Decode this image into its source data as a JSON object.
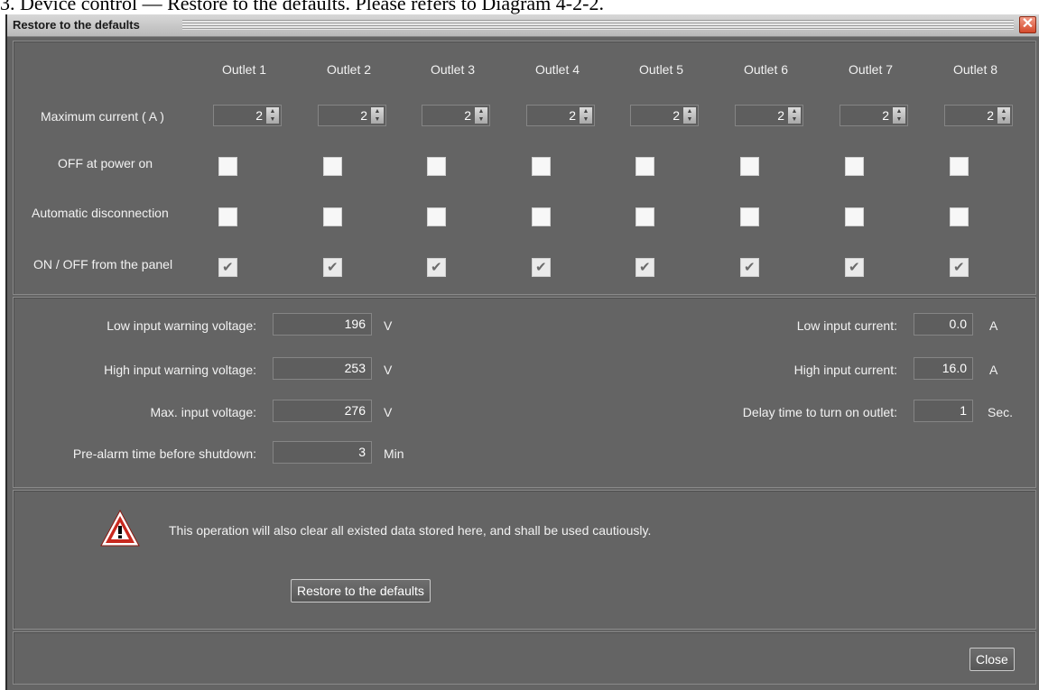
{
  "doc_caption": "3. Device control — Restore to the defaults. Please refers to Diagram 4-2-2.",
  "window": {
    "title": "Restore to the defaults"
  },
  "outlets": {
    "headers": [
      "Outlet 1",
      "Outlet 2",
      "Outlet 3",
      "Outlet 4",
      "Outlet 5",
      "Outlet 6",
      "Outlet 7",
      "Outlet 8"
    ],
    "max_current_label": "Maximum current ( A )",
    "max_current_values": [
      "2",
      "2",
      "2",
      "2",
      "2",
      "2",
      "2",
      "2"
    ],
    "off_at_power_on_label": "OFF at power on",
    "off_at_power_on": [
      false,
      false,
      false,
      false,
      false,
      false,
      false,
      false
    ],
    "auto_disconnect_label": "Automatic disconnection",
    "auto_disconnect": [
      false,
      false,
      false,
      false,
      false,
      false,
      false,
      false
    ],
    "panel_onoff_label": "ON / OFF from the panel",
    "panel_onoff": [
      true,
      true,
      true,
      true,
      true,
      true,
      true,
      true
    ]
  },
  "settings": {
    "low_input_warning_voltage": {
      "label": "Low input warning voltage:",
      "value": "196",
      "unit": "V"
    },
    "high_input_warning_voltage": {
      "label": "High input warning voltage:",
      "value": "253",
      "unit": "V"
    },
    "max_input_voltage": {
      "label": "Max. input voltage:",
      "value": "276",
      "unit": "V"
    },
    "pre_alarm_time": {
      "label": "Pre-alarm time before shutdown:",
      "value": "3",
      "unit": "Min"
    },
    "low_input_current": {
      "label": "Low input current:",
      "value": "0.0",
      "unit": "A"
    },
    "high_input_current": {
      "label": "High input current:",
      "value": "16.0",
      "unit": "A"
    },
    "delay_time": {
      "label": "Delay time to turn on outlet:",
      "value": "1",
      "unit": "Sec."
    }
  },
  "warning": {
    "text": "This operation will also clear all existed data stored here, and shall be used cautiously."
  },
  "buttons": {
    "restore": "Restore to the defaults",
    "close": "Close"
  },
  "icons": {
    "warning": "warning-triangle-icon",
    "close": "close-icon"
  },
  "colors": {
    "background": "#646464",
    "warning_red": "#c8281e"
  }
}
